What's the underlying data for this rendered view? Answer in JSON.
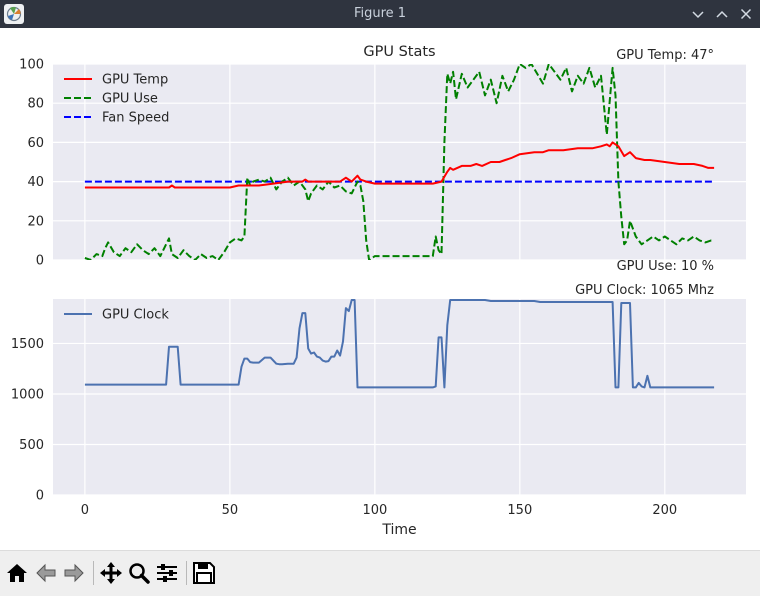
{
  "window": {
    "title": "Figure 1",
    "icons": {
      "app": "matplotlib-figure-icon",
      "minimize": "chevron-down-icon",
      "maximize": "chevron-up-icon",
      "close": "close-icon"
    }
  },
  "toolbar": {
    "buttons": [
      {
        "name": "home-button",
        "icon": "home-icon"
      },
      {
        "name": "back-button",
        "icon": "arrow-left-icon"
      },
      {
        "name": "forward-button",
        "icon": "arrow-right-icon"
      },
      {
        "name": "pan-button",
        "icon": "move-icon"
      },
      {
        "name": "zoom-button",
        "icon": "magnifier-icon"
      },
      {
        "name": "configure-subplots-button",
        "icon": "sliders-icon"
      },
      {
        "name": "save-button",
        "icon": "floppy-disk-icon"
      }
    ]
  },
  "colors": {
    "axes_background": "#eaeaf2",
    "grid": "#ffffff",
    "gpu_temp": "#ff0000",
    "gpu_use": "#008000",
    "fan_speed": "#0000ff",
    "gpu_clock": "#4c72b0"
  },
  "chart_data": [
    {
      "type": "line",
      "title": "GPU Stats",
      "annotations": {
        "top_right": "GPU Temp: 47°",
        "bottom_right": "GPU Use: 10 %"
      },
      "xlim": [
        -11,
        228
      ],
      "ylim": [
        0,
        100
      ],
      "xticks": [
        0,
        50,
        100,
        150,
        200
      ],
      "yticks": [
        0,
        20,
        40,
        60,
        80,
        100
      ],
      "yticklabels": [
        "0",
        "20",
        "40",
        "60",
        "80",
        "100"
      ],
      "grid": true,
      "legend": "top-left",
      "series": [
        {
          "name": "GPU Temp",
          "style": "solid",
          "x": [
            0,
            10,
            20,
            29,
            30,
            31,
            33,
            40,
            50,
            53,
            55,
            60,
            65,
            70,
            75,
            76,
            77,
            80,
            85,
            88,
            90,
            92,
            94,
            95,
            97,
            100,
            110,
            120,
            123,
            125,
            126,
            127,
            130,
            133,
            135,
            137,
            140,
            143,
            145,
            147,
            150,
            155,
            158,
            160,
            165,
            170,
            175,
            178,
            180,
            181,
            182,
            184,
            186,
            188,
            190,
            193,
            195,
            200,
            205,
            210,
            213,
            215,
            217
          ],
          "values": [
            37,
            37,
            37,
            37,
            38,
            37,
            37,
            37,
            37,
            38,
            38,
            38,
            39,
            40,
            40,
            41,
            40,
            40,
            40,
            40,
            42,
            40,
            43,
            41,
            40,
            39,
            39,
            39,
            40,
            45,
            47,
            46,
            48,
            48,
            49,
            48,
            50,
            50,
            51,
            52,
            54,
            55,
            55,
            56,
            56,
            57,
            57,
            58,
            59,
            58,
            60,
            58,
            53,
            55,
            52,
            51,
            51,
            50,
            49,
            49,
            48,
            47,
            47
          ]
        },
        {
          "name": "GPU Use",
          "style": "dashed",
          "x": [
            0,
            2,
            4,
            6,
            7,
            8,
            10,
            12,
            14,
            16,
            18,
            20,
            22,
            24,
            26,
            28,
            29,
            30,
            32,
            34,
            36,
            38,
            40,
            42,
            44,
            46,
            48,
            50,
            52,
            54,
            55,
            56,
            57,
            58,
            60,
            62,
            64,
            66,
            68,
            70,
            72,
            74,
            76,
            77,
            78,
            80,
            82,
            84,
            86,
            88,
            90,
            92,
            94,
            95,
            96,
            97,
            98,
            100,
            110,
            120,
            121,
            122,
            123,
            124,
            125,
            126,
            127,
            128,
            130,
            132,
            134,
            136,
            138,
            140,
            142,
            144,
            146,
            148,
            150,
            152,
            154,
            156,
            158,
            160,
            162,
            164,
            166,
            168,
            170,
            172,
            174,
            176,
            178,
            180,
            182,
            183,
            184,
            185,
            186,
            187,
            188,
            190,
            192,
            194,
            196,
            198,
            200,
            202,
            204,
            206,
            208,
            210,
            212,
            214,
            216,
            217
          ],
          "values": [
            1,
            0,
            3,
            2,
            6,
            9,
            4,
            2,
            6,
            4,
            8,
            5,
            3,
            6,
            2,
            8,
            11,
            3,
            1,
            5,
            2,
            0,
            3,
            1,
            2,
            0,
            4,
            9,
            11,
            10,
            12,
            42,
            38,
            40,
            41,
            40,
            42,
            36,
            40,
            42,
            38,
            40,
            36,
            30,
            34,
            38,
            36,
            40,
            37,
            38,
            35,
            34,
            40,
            38,
            30,
            10,
            0,
            2,
            2,
            2,
            12,
            5,
            3,
            60,
            95,
            90,
            96,
            82,
            95,
            88,
            92,
            96,
            84,
            92,
            80,
            94,
            86,
            92,
            100,
            98,
            100,
            95,
            90,
            100,
            96,
            92,
            98,
            86,
            94,
            90,
            98,
            88,
            94,
            64,
            98,
            84,
            40,
            22,
            8,
            10,
            20,
            12,
            8,
            10,
            12,
            10,
            12,
            10,
            8,
            11,
            10,
            12,
            10,
            9,
            10,
            10
          ]
        },
        {
          "name": "Fan Speed",
          "style": "dashed",
          "x": [
            0,
            217
          ],
          "values": [
            40,
            40
          ]
        }
      ]
    },
    {
      "type": "line",
      "annotations": {
        "top_right": "GPU Clock: 1065 Mhz"
      },
      "xlabel": "Time",
      "xlim": [
        -11,
        228
      ],
      "ylim": [
        0,
        1940
      ],
      "xticks": [
        0,
        50,
        100,
        150,
        200
      ],
      "yticks": [
        0,
        500,
        1000,
        1500
      ],
      "yticklabels": [
        "0",
        "500",
        "1000",
        "1500"
      ],
      "grid": true,
      "legend": "top-left",
      "series": [
        {
          "name": "GPU Clock",
          "style": "solid",
          "x": [
            0,
            10,
            20,
            28,
            29,
            30,
            32,
            33,
            40,
            50,
            53,
            54,
            55,
            56,
            57,
            58,
            60,
            62,
            63,
            64,
            66,
            67,
            68,
            70,
            72,
            73,
            74,
            75,
            76,
            77,
            78,
            79,
            80,
            81,
            82,
            83,
            84,
            85,
            86,
            87,
            88,
            89,
            90,
            91,
            92,
            93,
            94,
            95,
            96,
            97,
            98,
            100,
            110,
            120,
            121,
            122,
            123,
            124,
            125,
            126,
            127,
            130,
            135,
            138,
            140,
            145,
            150,
            155,
            157,
            160,
            165,
            170,
            175,
            180,
            182,
            183,
            184,
            185,
            186,
            187,
            188,
            189,
            190,
            191,
            192,
            193,
            194,
            195,
            200,
            205,
            210,
            217
          ],
          "values": [
            1093,
            1093,
            1093,
            1093,
            1468,
            1468,
            1468,
            1093,
            1093,
            1093,
            1093,
            1270,
            1350,
            1350,
            1315,
            1310,
            1310,
            1360,
            1360,
            1360,
            1300,
            1295,
            1295,
            1300,
            1300,
            1360,
            1650,
            1800,
            1800,
            1450,
            1400,
            1410,
            1370,
            1360,
            1330,
            1320,
            1325,
            1370,
            1370,
            1430,
            1380,
            1520,
            1850,
            1820,
            1930,
            1930,
            1065,
            1065,
            1065,
            1065,
            1065,
            1065,
            1065,
            1065,
            1075,
            1560,
            1560,
            1065,
            1680,
            1930,
            1930,
            1930,
            1930,
            1930,
            1920,
            1920,
            1920,
            1920,
            1910,
            1910,
            1910,
            1910,
            1910,
            1910,
            1910,
            1065,
            1065,
            1900,
            1900,
            1900,
            1900,
            1065,
            1065,
            1110,
            1075,
            1065,
            1180,
            1065,
            1065,
            1065,
            1065,
            1065
          ]
        }
      ]
    }
  ]
}
